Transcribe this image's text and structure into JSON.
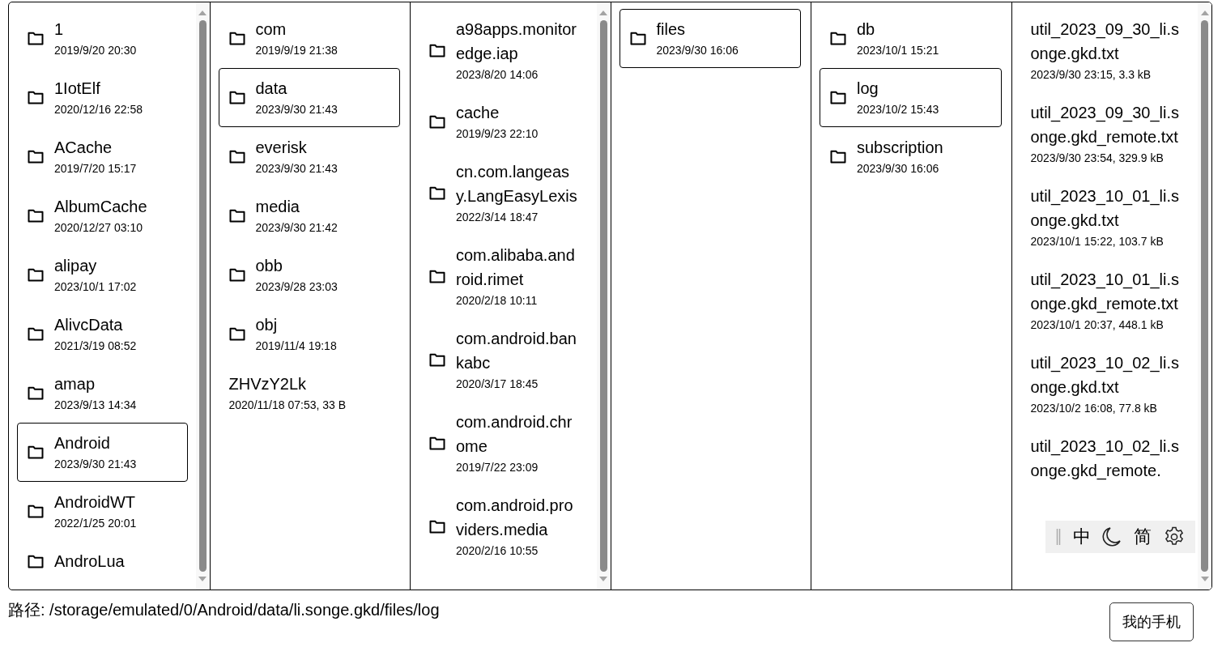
{
  "columns": [
    {
      "scrollable": true,
      "items": [
        {
          "kind": "folder",
          "name": "1",
          "meta": "2019/9/20 20:30",
          "selected": false
        },
        {
          "kind": "folder",
          "name": "1IotElf",
          "meta": "2020/12/16 22:58",
          "selected": false
        },
        {
          "kind": "folder",
          "name": "ACache",
          "meta": "2019/7/20 15:17",
          "selected": false
        },
        {
          "kind": "folder",
          "name": "AlbumCache",
          "meta": "2020/12/27 03:10",
          "selected": false
        },
        {
          "kind": "folder",
          "name": "alipay",
          "meta": "2023/10/1 17:02",
          "selected": false
        },
        {
          "kind": "folder",
          "name": "AlivcData",
          "meta": "2021/3/19 08:52",
          "selected": false
        },
        {
          "kind": "folder",
          "name": "amap",
          "meta": "2023/9/13 14:34",
          "selected": false
        },
        {
          "kind": "folder",
          "name": "Android",
          "meta": "2023/9/30 21:43",
          "selected": true
        },
        {
          "kind": "folder",
          "name": "AndroidWT",
          "meta": "2022/1/25 20:01",
          "selected": false
        },
        {
          "kind": "folder",
          "name": "AndroLua",
          "selected": false
        }
      ]
    },
    {
      "scrollable": false,
      "items": [
        {
          "kind": "folder",
          "name": "com",
          "meta": "2019/9/19 21:38",
          "selected": false
        },
        {
          "kind": "folder",
          "name": "data",
          "meta": "2023/9/30 21:43",
          "selected": true
        },
        {
          "kind": "folder",
          "name": "everisk",
          "meta": "2023/9/30 21:43",
          "selected": false
        },
        {
          "kind": "folder",
          "name": "media",
          "meta": "2023/9/30 21:42",
          "selected": false
        },
        {
          "kind": "folder",
          "name": "obb",
          "meta": "2023/9/28 23:03",
          "selected": false
        },
        {
          "kind": "folder",
          "name": "obj",
          "meta": "2019/11/4 19:18",
          "selected": false
        },
        {
          "kind": "file",
          "name": "ZHVzY2Lk",
          "meta": "2020/11/18 07:53, 33 B",
          "selected": false
        }
      ]
    },
    {
      "scrollable": true,
      "items": [
        {
          "kind": "folder",
          "name": "a98apps.monitoredge.iap",
          "meta": "2023/8/20 14:06",
          "selected": false
        },
        {
          "kind": "folder",
          "name": "cache",
          "meta": "2019/9/23 22:10",
          "selected": false
        },
        {
          "kind": "folder",
          "name": "cn.com.langeasy.LangEasyLexis",
          "meta": "2022/3/14 18:47",
          "selected": false
        },
        {
          "kind": "folder",
          "name": "com.alibaba.android.rimet",
          "meta": "2020/2/18 10:11",
          "selected": false
        },
        {
          "kind": "folder",
          "name": "com.android.bankabc",
          "meta": "2020/3/17 18:45",
          "selected": false
        },
        {
          "kind": "folder",
          "name": "com.android.chrome",
          "meta": "2019/7/22 23:09",
          "selected": false
        },
        {
          "kind": "folder",
          "name": "com.android.providers.media",
          "meta": "2020/2/16 10:55",
          "selected": false
        }
      ]
    },
    {
      "scrollable": false,
      "items": [
        {
          "kind": "folder",
          "name": "files",
          "meta": "2023/9/30 16:06",
          "selected": true
        }
      ]
    },
    {
      "scrollable": false,
      "items": [
        {
          "kind": "folder",
          "name": "db",
          "meta": "2023/10/1 15:21",
          "selected": false
        },
        {
          "kind": "folder",
          "name": "log",
          "meta": "2023/10/2 15:43",
          "selected": true
        },
        {
          "kind": "folder",
          "name": "subscription",
          "meta": "2023/9/30 16:06",
          "selected": false
        }
      ]
    },
    {
      "scrollable": true,
      "items": [
        {
          "kind": "file",
          "name": "util_2023_09_30_li.songe.gkd.txt",
          "meta": "2023/9/30 23:15, 3.3 kB",
          "selected": false
        },
        {
          "kind": "file",
          "name": "util_2023_09_30_li.songe.gkd_remote.txt",
          "meta": "2023/9/30 23:54, 329.9 kB",
          "selected": false
        },
        {
          "kind": "file",
          "name": "util_2023_10_01_li.songe.gkd.txt",
          "meta": "2023/10/1 15:22, 103.7 kB",
          "selected": false
        },
        {
          "kind": "file",
          "name": "util_2023_10_01_li.songe.gkd_remote.txt",
          "meta": "2023/10/1 20:37, 448.1 kB",
          "selected": false
        },
        {
          "kind": "file",
          "name": "util_2023_10_02_li.songe.gkd.txt",
          "meta": "2023/10/2 16:08, 77.8 kB",
          "selected": false
        },
        {
          "kind": "file",
          "name": "util_2023_10_02_li.songe.gkd_remote.",
          "selected": false
        }
      ]
    }
  ],
  "path": {
    "label": "路径:",
    "value": "/storage/emulated/0/Android/data/li.songe.gkd/files/log"
  },
  "button": "我的手机",
  "toolbar": [
    {
      "kind": "grip"
    },
    {
      "kind": "text",
      "label": "中"
    },
    {
      "kind": "moon"
    },
    {
      "kind": "text",
      "label": "简"
    },
    {
      "kind": "gear"
    }
  ]
}
